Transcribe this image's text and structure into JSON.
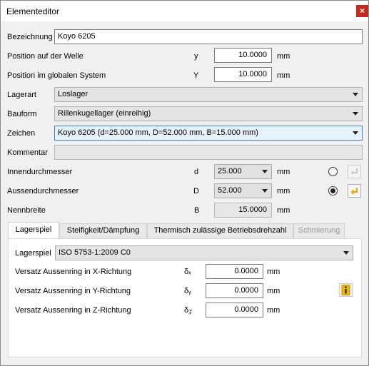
{
  "window": {
    "title": "Elementeditor",
    "close": "×"
  },
  "fields": {
    "bezeichnung": {
      "label": "Bezeichnung",
      "value": "Koyo 6205"
    },
    "pos_welle": {
      "label": "Position auf der Welle",
      "symbol": "y",
      "value": "10.0000",
      "unit": "mm"
    },
    "pos_global": {
      "label": "Position im globalen System",
      "symbol": "Y",
      "value": "10.0000",
      "unit": "mm"
    },
    "lagerart": {
      "label": "Lagerart",
      "value": "Loslager"
    },
    "bauform": {
      "label": "Bauform",
      "value": "Rillenkugellager (einreihig)"
    },
    "zeichen": {
      "label": "Zeichen",
      "value": "Koyo 6205 (d=25.000 mm, D=52.000 mm, B=15.000 mm)"
    },
    "kommentar": {
      "label": "Kommentar",
      "value": ""
    },
    "innen": {
      "label": "Innendurchmesser",
      "symbol": "d",
      "value": "25.000",
      "unit": "mm"
    },
    "aussen": {
      "label": "Aussendurchmesser",
      "symbol": "D",
      "value": "52.000",
      "unit": "mm"
    },
    "breite": {
      "label": "Nennbreite",
      "symbol": "B",
      "value": "15.0000",
      "unit": "mm"
    }
  },
  "radios": {
    "innen_selected": false,
    "aussen_selected": true
  },
  "icons": {
    "innen_icon": "arrow-return-icon",
    "aussen_icon": "arrow-return-icon",
    "info_icon": "info-icon"
  },
  "tabs": [
    {
      "label": "Lagerspiel",
      "active": true
    },
    {
      "label": "Steifigkeit/Dämpfung",
      "active": false
    },
    {
      "label": "Thermisch zulässige Betriebsdrehzahl",
      "active": false
    },
    {
      "label": "Schmierung",
      "active": false,
      "disabled": true
    }
  ],
  "lagerspiel": {
    "label": "Lagerspiel",
    "value": "ISO 5753-1:2009 C0",
    "versatz_x": {
      "label": "Versatz Aussenring in X-Richtung",
      "symbol": "δₓ",
      "value": "0.0000",
      "unit": "mm"
    },
    "versatz_y": {
      "label": "Versatz Aussenring in Y-Richtung",
      "symbol": "δᵧ",
      "value": "0.0000",
      "unit": "mm"
    },
    "versatz_z": {
      "label": "Versatz Aussenring in Z-Richtung",
      "symbol": "δ𝓏",
      "value": "0.0000",
      "unit": "mm"
    }
  },
  "colors": {
    "accent": "#e7a800",
    "close": "#c42b1c"
  }
}
